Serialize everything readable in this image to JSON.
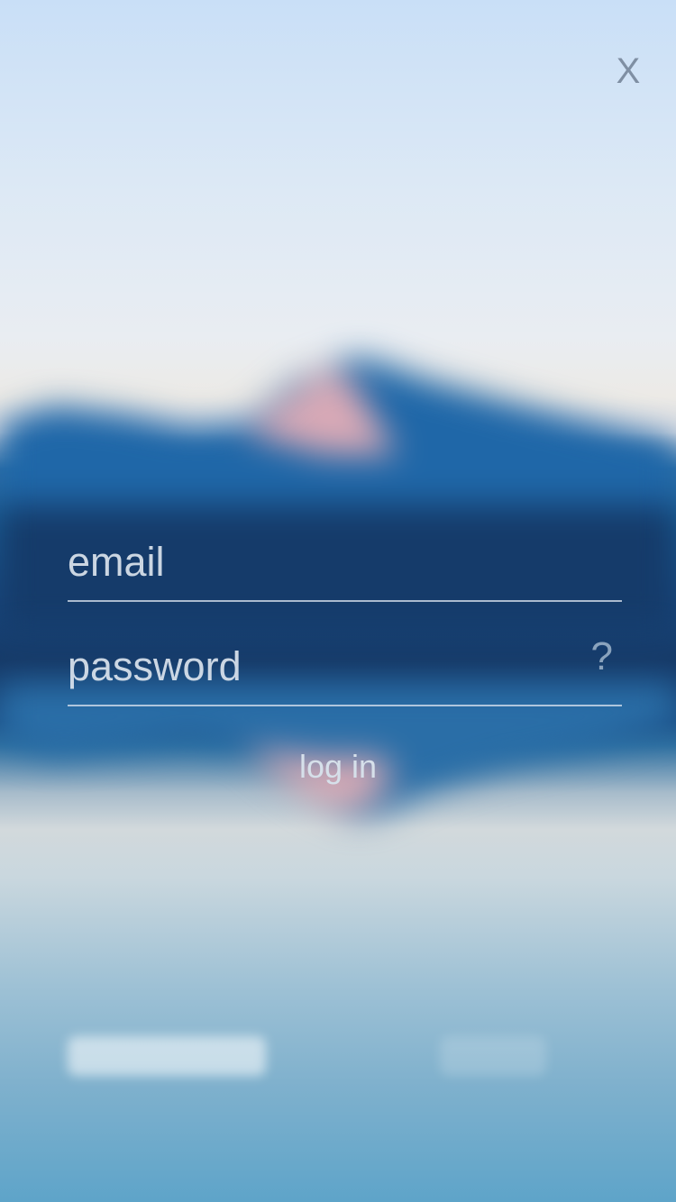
{
  "app": {
    "close_label": "X"
  },
  "login_form": {
    "email_placeholder": "email",
    "password_placeholder": "password",
    "help_label": "?",
    "login_label": "log in"
  },
  "colors": {
    "sky": "#c9dff7",
    "mountain": "#1a5f97",
    "lake": "#5ea4c9",
    "text": "#e4ebf3"
  },
  "icons": {
    "close": "close-icon",
    "help": "help-icon"
  }
}
